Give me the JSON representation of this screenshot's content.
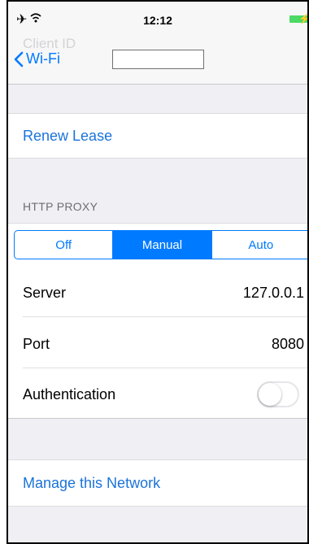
{
  "status_bar": {
    "time": "12:12"
  },
  "nav": {
    "ghost_title": "Client ID",
    "back_label": "Wi-Fi",
    "client_id_value": ""
  },
  "actions": {
    "renew_lease": "Renew Lease",
    "manage_network": "Manage this Network"
  },
  "http_proxy": {
    "header": "HTTP PROXY",
    "segments": [
      "Off",
      "Manual",
      "Auto"
    ],
    "selected": "Manual",
    "server_label": "Server",
    "server_value": "127.0.0.1",
    "port_label": "Port",
    "port_value": "8080",
    "auth_label": "Authentication",
    "auth_enabled": false
  },
  "colors": {
    "accent": "#007aff",
    "battery": "#4cd964",
    "background": "#efeff4"
  }
}
